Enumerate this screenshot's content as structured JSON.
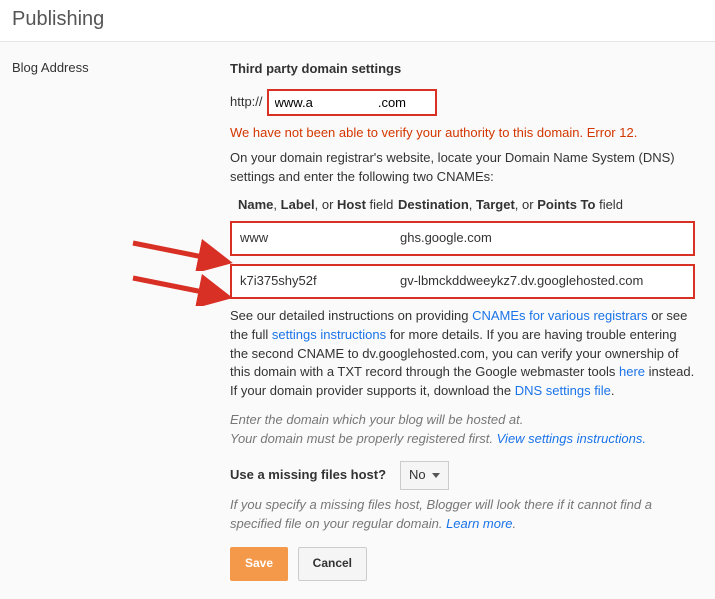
{
  "header": {
    "title": "Publishing"
  },
  "sidebar": {
    "label": "Blog Address"
  },
  "domain": {
    "section_title": "Third party domain settings",
    "http_prefix": "http://",
    "input_value": "www.a                  .com",
    "error_msg": "We have not been able to verify your authority to this domain. Error 12.",
    "instruction": "On your domain registrar's website, locate your Domain Name System (DNS) settings and enter the following two CNAMEs:"
  },
  "cname_header": {
    "col1_a": "Name",
    "col1_b": "Label",
    "col1_c": "Host",
    "col2_a": "Destination",
    "col2_b": "Target",
    "col2_c": "Points To",
    "field_suffix": " field"
  },
  "cname1": {
    "name": "www",
    "dest": "ghs.google.com"
  },
  "cname2": {
    "name": "k7i375shy52f",
    "dest": "gv-lbmckddweeykz7.dv.googlehosted.com"
  },
  "detail": {
    "p1a": "See our detailed instructions on providing ",
    "link1": "CNAMEs for various registrars",
    "p1b": " or see the full ",
    "link2": "settings instructions",
    "p1c": " for more details. If you are having trouble entering the second CNAME to dv.googlehosted.com, you can verify your ownership of this domain with a TXT record through the Google webmaster tools ",
    "link3": "here",
    "p1d": " instead.",
    "p2a": "If your domain provider supports it, download the ",
    "link4": "DNS settings file",
    "p2b": "."
  },
  "hint": {
    "line1": "Enter the domain which your blog will be hosted at.",
    "line2a": "Your domain must be properly registered first. ",
    "link": "View settings instructions."
  },
  "missing": {
    "label": "Use a missing files host?",
    "value": "No",
    "desc_a": "If you specify a missing files host, Blogger will look there if it cannot find a specified file on your regular domain. ",
    "link": "Learn more",
    "desc_b": "."
  },
  "buttons": {
    "save": "Save",
    "cancel": "Cancel"
  }
}
